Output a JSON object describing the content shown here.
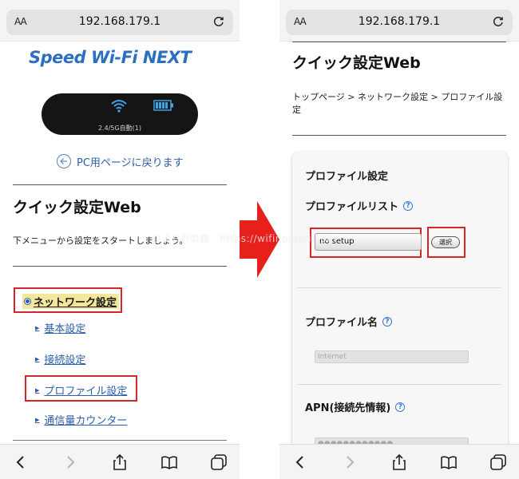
{
  "browser": {
    "text_size_label": "AA",
    "url": "192.168.179.1"
  },
  "left_page": {
    "brand": "Speed Wi-Fi NEXT",
    "device_status": "2.4/5G自動(1)",
    "pc_link": "PC用ページに戻ります",
    "title": "クイック設定Web",
    "description": "下メニューから設定をスタートしましょう。",
    "menu": {
      "network_settings": "ネットワーク設定",
      "items": [
        "基本設定",
        "接続設定",
        "プロファイル設定",
        "通信量カウンター"
      ]
    }
  },
  "right_page": {
    "title": "クイック設定Web",
    "breadcrumb": "トップページ > ネットワーク設定 > プロファイル設定",
    "section_title": "プロファイル設定",
    "profile_list_label": "プロファイルリスト",
    "profile_select_value": "no setup",
    "select_button": "選択",
    "profile_name_label": "プロファイル名",
    "profile_name_value": "Internet",
    "apn_label": "APN(接続先情報)",
    "apn_value": "●●●●●●●●●●●●"
  },
  "watermark": "ひよりFiの森　https://wifinomori.com",
  "colors": {
    "highlight_border": "#d9252a",
    "link": "#2b5fa8",
    "brand": "#2b6fc2",
    "arrow": "#e8201c"
  }
}
